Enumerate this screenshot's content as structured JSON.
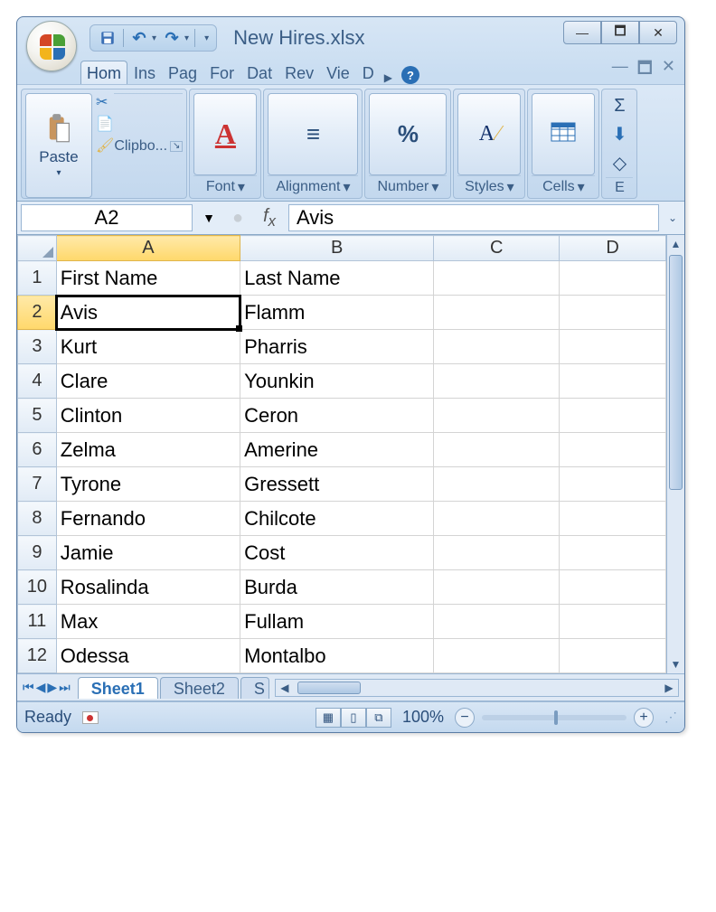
{
  "window": {
    "title": "New Hires.xlsx"
  },
  "tabs": [
    "Hom",
    "Ins",
    "Pag",
    "For",
    "Dat",
    "Rev",
    "Vie",
    "D"
  ],
  "active_tab": 0,
  "ribbon": {
    "clipboard": "Clipbo...",
    "paste": "Paste",
    "font": "Font",
    "alignment": "Alignment",
    "number": "Number",
    "styles": "Styles",
    "cells": "Cells",
    "editing": "E"
  },
  "namebox": "A2",
  "formula_content": "Avis",
  "columns": [
    "A",
    "B",
    "C",
    "D"
  ],
  "selected_col": "A",
  "selected_row": 2,
  "rows": [
    {
      "n": 1,
      "a": "First Name",
      "b": "Last Name"
    },
    {
      "n": 2,
      "a": "Avis",
      "b": "Flamm"
    },
    {
      "n": 3,
      "a": "Kurt",
      "b": "Pharris"
    },
    {
      "n": 4,
      "a": "Clare",
      "b": "Younkin"
    },
    {
      "n": 5,
      "a": "Clinton",
      "b": "Ceron"
    },
    {
      "n": 6,
      "a": "Zelma",
      "b": "Amerine"
    },
    {
      "n": 7,
      "a": "Tyrone",
      "b": "Gressett"
    },
    {
      "n": 8,
      "a": "Fernando",
      "b": "Chilcote"
    },
    {
      "n": 9,
      "a": "Jamie",
      "b": "Cost"
    },
    {
      "n": 10,
      "a": "Rosalinda",
      "b": "Burda"
    },
    {
      "n": 11,
      "a": "Max",
      "b": "Fullam"
    },
    {
      "n": 12,
      "a": "Odessa",
      "b": "Montalbo"
    }
  ],
  "sheet_tabs": [
    "Sheet1",
    "Sheet2",
    "S"
  ],
  "active_sheet": 0,
  "status": {
    "ready": "Ready",
    "zoom": "100%"
  }
}
